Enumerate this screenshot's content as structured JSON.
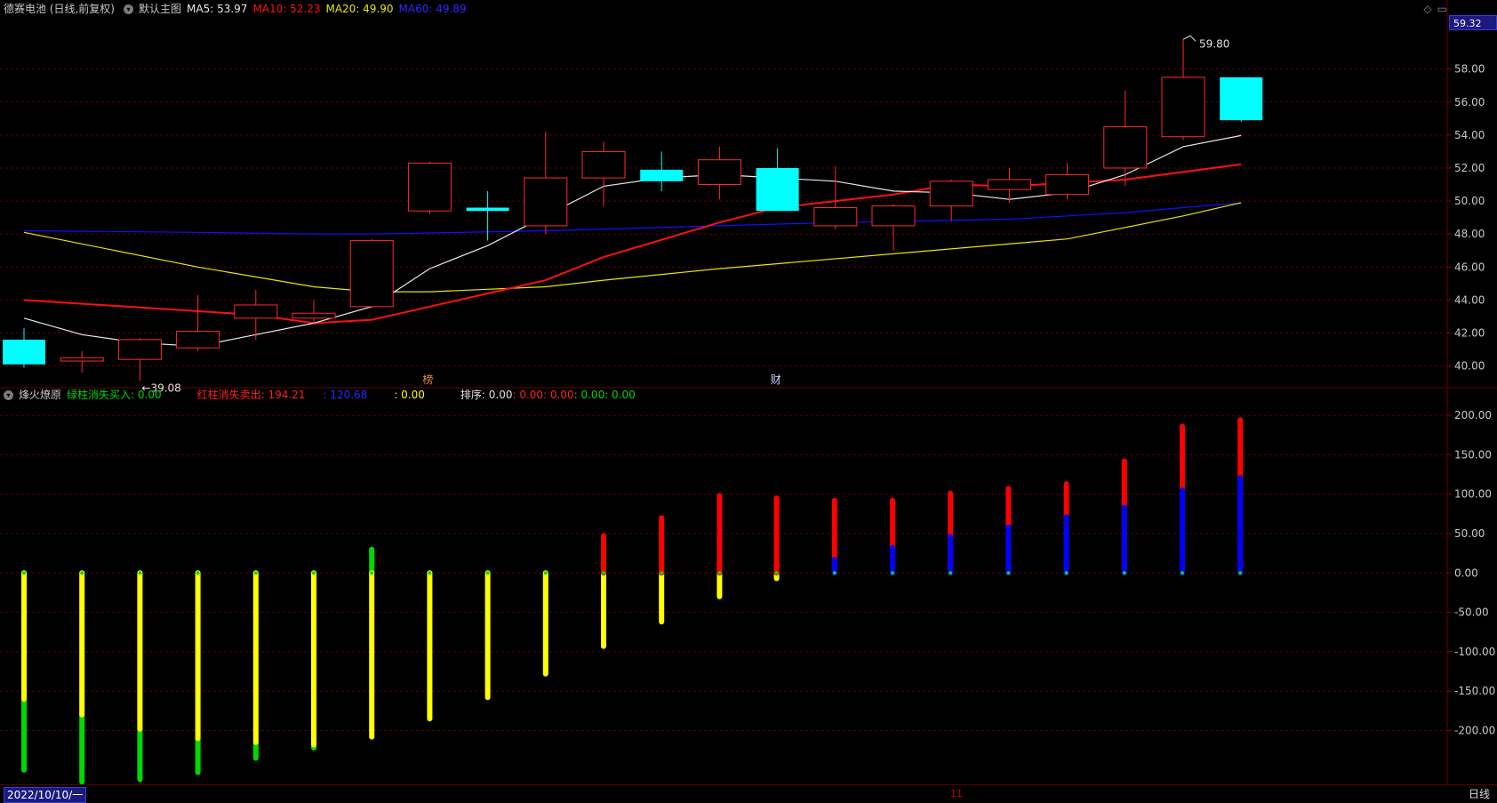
{
  "main_header": {
    "stock": "德赛电池 (日线,前复权)",
    "template": "默认主图",
    "ma5": "MA5: 53.97",
    "ma10": "MA10: 52.23",
    "ma20": "MA20: 49.90",
    "ma60": "MA60: 49.89"
  },
  "indicator_header": {
    "name": "烽火燎原",
    "green_label": "绿柱消失买入: 0.00",
    "red_label": "红柱消失卖出: 194.21",
    "blue_label": ": 120.68",
    "yellow_label": ": 0.00",
    "sort_label": "排序: 0.00",
    "red_val": ": 0.00",
    "white_val": ": 0.00",
    "green_val": ": 0.00",
    "green_val2": ": 0.00"
  },
  "current_price": "59.32",
  "high_annotation": "59.80",
  "low_annotation": "←39.08",
  "markers": {
    "m1": "榜",
    "m2": "财"
  },
  "bottom": {
    "date": "2022/10/10/一",
    "period": "日线",
    "cursor": "11"
  },
  "colors": {
    "up": "#ff2a2a",
    "down": "#00ffff",
    "ma5": "#e8e8e8",
    "ma10": "#ff1010",
    "ma20": "#e8e800",
    "ma60": "#1010ff",
    "ind_yellow": "#ffff00",
    "ind_green": "#00d800",
    "ind_red": "#ff0000",
    "ind_blue": "#0000ff"
  },
  "chart_data": {
    "type": "candlestick",
    "y_axis_main": {
      "ticks": [
        "58.00",
        "56.00",
        "54.00",
        "52.00",
        "50.00",
        "48.00",
        "46.00",
        "44.00",
        "42.00",
        "40.00"
      ],
      "ylim": [
        38.9,
        61.0
      ]
    },
    "candles": [
      {
        "o": 41.6,
        "h": 42.3,
        "l": 39.9,
        "c": 40.1
      },
      {
        "o": 40.3,
        "h": 40.9,
        "l": 39.6,
        "c": 40.5
      },
      {
        "o": 40.4,
        "h": 41.7,
        "l": 39.1,
        "c": 41.6
      },
      {
        "o": 41.1,
        "h": 44.3,
        "l": 40.9,
        "c": 42.1
      },
      {
        "o": 42.9,
        "h": 44.6,
        "l": 41.6,
        "c": 43.7
      },
      {
        "o": 42.9,
        "h": 44.0,
        "l": 42.5,
        "c": 43.2
      },
      {
        "o": 43.6,
        "h": 47.7,
        "l": 43.5,
        "c": 47.6
      },
      {
        "o": 49.4,
        "h": 52.4,
        "l": 49.2,
        "c": 52.3
      },
      {
        "o": 49.6,
        "h": 50.6,
        "l": 47.6,
        "c": 49.4
      },
      {
        "o": 48.5,
        "h": 54.2,
        "l": 48.0,
        "c": 51.4
      },
      {
        "o": 51.4,
        "h": 53.6,
        "l": 49.7,
        "c": 53.0
      },
      {
        "o": 51.9,
        "h": 53.0,
        "l": 50.6,
        "c": 51.2
      },
      {
        "o": 51.0,
        "h": 53.3,
        "l": 50.1,
        "c": 52.5
      },
      {
        "o": 52.0,
        "h": 53.2,
        "l": 49.4,
        "c": 49.4
      },
      {
        "o": 48.5,
        "h": 52.1,
        "l": 48.3,
        "c": 49.6
      },
      {
        "o": 48.5,
        "h": 49.8,
        "l": 47.0,
        "c": 49.7
      },
      {
        "o": 49.7,
        "h": 51.3,
        "l": 48.8,
        "c": 51.2
      },
      {
        "o": 50.7,
        "h": 52.0,
        "l": 49.9,
        "c": 51.3
      },
      {
        "o": 50.4,
        "h": 52.3,
        "l": 50.1,
        "c": 51.6
      },
      {
        "o": 52.0,
        "h": 56.7,
        "l": 50.9,
        "c": 54.5
      },
      {
        "o": 53.9,
        "h": 59.8,
        "l": 53.7,
        "c": 57.5
      },
      {
        "o": 57.5,
        "h": 57.5,
        "l": 54.8,
        "c": 54.9
      }
    ],
    "ma5": [
      42.9,
      41.9,
      41.4,
      41.2,
      41.9,
      42.6,
      43.6,
      45.9,
      47.3,
      49.1,
      50.9,
      51.4,
      51.6,
      51.4,
      51.2,
      50.6,
      50.5,
      50.1,
      50.5,
      51.6,
      53.3,
      53.97
    ],
    "ma10": [
      44.0,
      null,
      null,
      null,
      43.1,
      42.6,
      42.8,
      null,
      44.4,
      45.2,
      46.6,
      null,
      48.7,
      49.6,
      null,
      50.4,
      51.0,
      50.9,
      null,
      51.3,
      null,
      52.23
    ],
    "ma20": [
      48.1,
      null,
      null,
      46.0,
      null,
      44.8,
      44.5,
      44.5,
      null,
      44.8,
      45.2,
      null,
      45.9,
      null,
      null,
      null,
      null,
      null,
      47.7,
      48.4,
      49.1,
      49.9
    ],
    "ma60": [
      48.2,
      null,
      null,
      48.1,
      null,
      48.0,
      48.0,
      null,
      null,
      48.2,
      48.3,
      null,
      48.5,
      null,
      48.7,
      null,
      null,
      48.9,
      49.1,
      49.3,
      49.6,
      49.89
    ],
    "y_axis_ind": {
      "ticks": [
        "200.00",
        "150.00",
        "100.00",
        "50.00",
        "0.00",
        "-50.00",
        "-100.00",
        "-150.00",
        "-200.00"
      ],
      "ylim": [
        -266,
        217
      ]
    },
    "ind_bars": [
      {
        "yellow": -160,
        "green": -250
      },
      {
        "yellow": -180,
        "green": -265
      },
      {
        "yellow": -198,
        "green": -262
      },
      {
        "yellow": -210,
        "green": -253
      },
      {
        "yellow": -215,
        "green": -235
      },
      {
        "yellow": -218,
        "green": -222
      },
      {
        "yellow": -208,
        "green": 30
      },
      {
        "yellow": -185
      },
      {
        "yellow": -158
      },
      {
        "yellow": -128
      },
      {
        "yellow": -93,
        "red": 47
      },
      {
        "yellow": -62,
        "red": 70
      },
      {
        "yellow": -30,
        "red": 98
      },
      {
        "yellow": -7,
        "red": 95
      },
      {
        "red": 92,
        "blue": 17
      },
      {
        "red": 92,
        "blue": 32
      },
      {
        "red": 101,
        "blue": 46
      },
      {
        "red": 107,
        "blue": 58
      },
      {
        "red": 113,
        "blue": 71
      },
      {
        "red": 142,
        "blue": 83
      },
      {
        "red": 186,
        "blue": 105
      },
      {
        "red": 194.21,
        "blue": 120.68
      }
    ]
  }
}
